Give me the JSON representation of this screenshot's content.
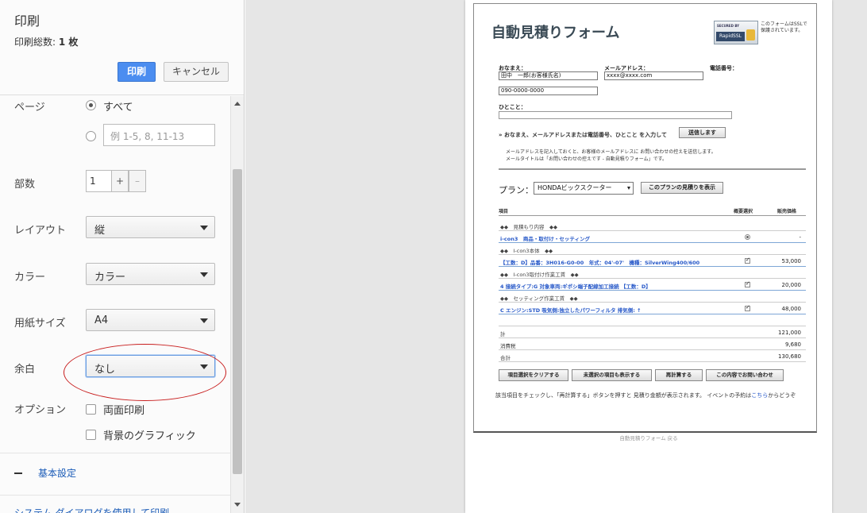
{
  "dialog": {
    "title": "印刷",
    "total_label": "印刷総数: ",
    "total_value": "1 枚",
    "print_label": "印刷",
    "cancel_label": "キャンセル"
  },
  "settings": {
    "pages_label": "ページ",
    "pages_all": "すべて",
    "pages_placeholder": "例 1-5, 8, 11-13",
    "copies_label": "部数",
    "copies_value": "1",
    "plus": "+",
    "minus": "–",
    "layout_label": "レイアウト",
    "layout_value": "縦",
    "color_label": "カラー",
    "color_value": "カラー",
    "paper_label": "用紙サイズ",
    "paper_value": "A4",
    "margin_label": "余白",
    "margin_value": "なし",
    "options_label": "オプション",
    "duplex_label": "両面印刷",
    "background_label": "背景のグラフィック",
    "basic_settings": "基本設定",
    "system_dialog": "システム ダイアログを使用して印刷..."
  },
  "preview": {
    "form_title": "自動見積りフォーム",
    "ssl_top": "SECURED BY",
    "ssl_name": "RapidSSL",
    "ssl_note": "このフォームはSSLで保護されています。",
    "name_label": "おなまえ：",
    "name_value": "田中　一郎(お客様氏名)",
    "email_label": "メールアドレス：",
    "email_value": "xxxx@xxxx.com",
    "phone_label": "電話番号：",
    "phone_value": "090-0000-0000",
    "comment_label": "ひとこと：",
    "send_instruction": "» おなまえ、メールアドレスまたは電話番号、ひとこと を入力して",
    "send_button": "送信します",
    "note1": "メールアドレスを記入しておくと、お客様のメールアドレスに お問い合わせの控えを送信します。",
    "note2": "メールタイトルは「お問い合わせの控えです - 自動見積りフォーム」です。",
    "plan_label": "プラン：",
    "plan_value": "HONDAビックスクーター",
    "plan_button": "このプランの見積りを表示",
    "col_item": "項目",
    "col_select": "概要選択",
    "col_price": "販売価格",
    "rows": [
      {
        "type": "section",
        "name": "◆◆　見積もり内容　◆◆",
        "mark": "",
        "price": ""
      },
      {
        "type": "item",
        "name": "i-con3　商品・取付け・セッティング",
        "mark": "radio",
        "price": "-"
      },
      {
        "type": "section",
        "name": "◆◆　I-con3本体　◆◆",
        "mark": "",
        "price": ""
      },
      {
        "type": "item",
        "name": "【工数：D】品番：3H016-G0-00　年式：04'-07'　機種：SilverWing400/600",
        "mark": "check",
        "price": "53,000"
      },
      {
        "type": "section",
        "name": "◆◆　I-con3取付け作業工賃　◆◆",
        "mark": "",
        "price": ""
      },
      {
        "type": "item",
        "name": "4 接続タイプ:G 対象車両:ギボシ端子配線加工接続 【工数：D】",
        "mark": "check",
        "price": "20,000"
      },
      {
        "type": "section",
        "name": "◆◆　セッティング作業工賃　◆◆",
        "mark": "",
        "price": ""
      },
      {
        "type": "item",
        "name": "C エンジン:STD 吸気側:独立したパワーフィルタ 排気側: ↑",
        "mark": "check",
        "price": "48,000"
      }
    ],
    "sums": [
      {
        "name": "計",
        "price": "121,000"
      },
      {
        "name": "消費税",
        "price": "9,680"
      },
      {
        "name": "合計",
        "price": "130,680"
      }
    ],
    "btn_clear": "項目選択をクリアする",
    "btn_show_unselected": "未選択の項目も表示する",
    "btn_recalc": "再計算する",
    "btn_inquiry": "この内容でお問い合わせ",
    "footer_text": "該当項目をチェックし、「再計算する」ボタンを押すと 見積り金額が表示されます。 イベントの予約は",
    "footer_link": "こちら",
    "footer_tail": "からどうぞ",
    "page_footer": "自動見積りフォーム 戻る"
  },
  "colors": {
    "accent": "#4b8df0",
    "annotation": "#c81e1e",
    "link": "#1a5bb7"
  }
}
